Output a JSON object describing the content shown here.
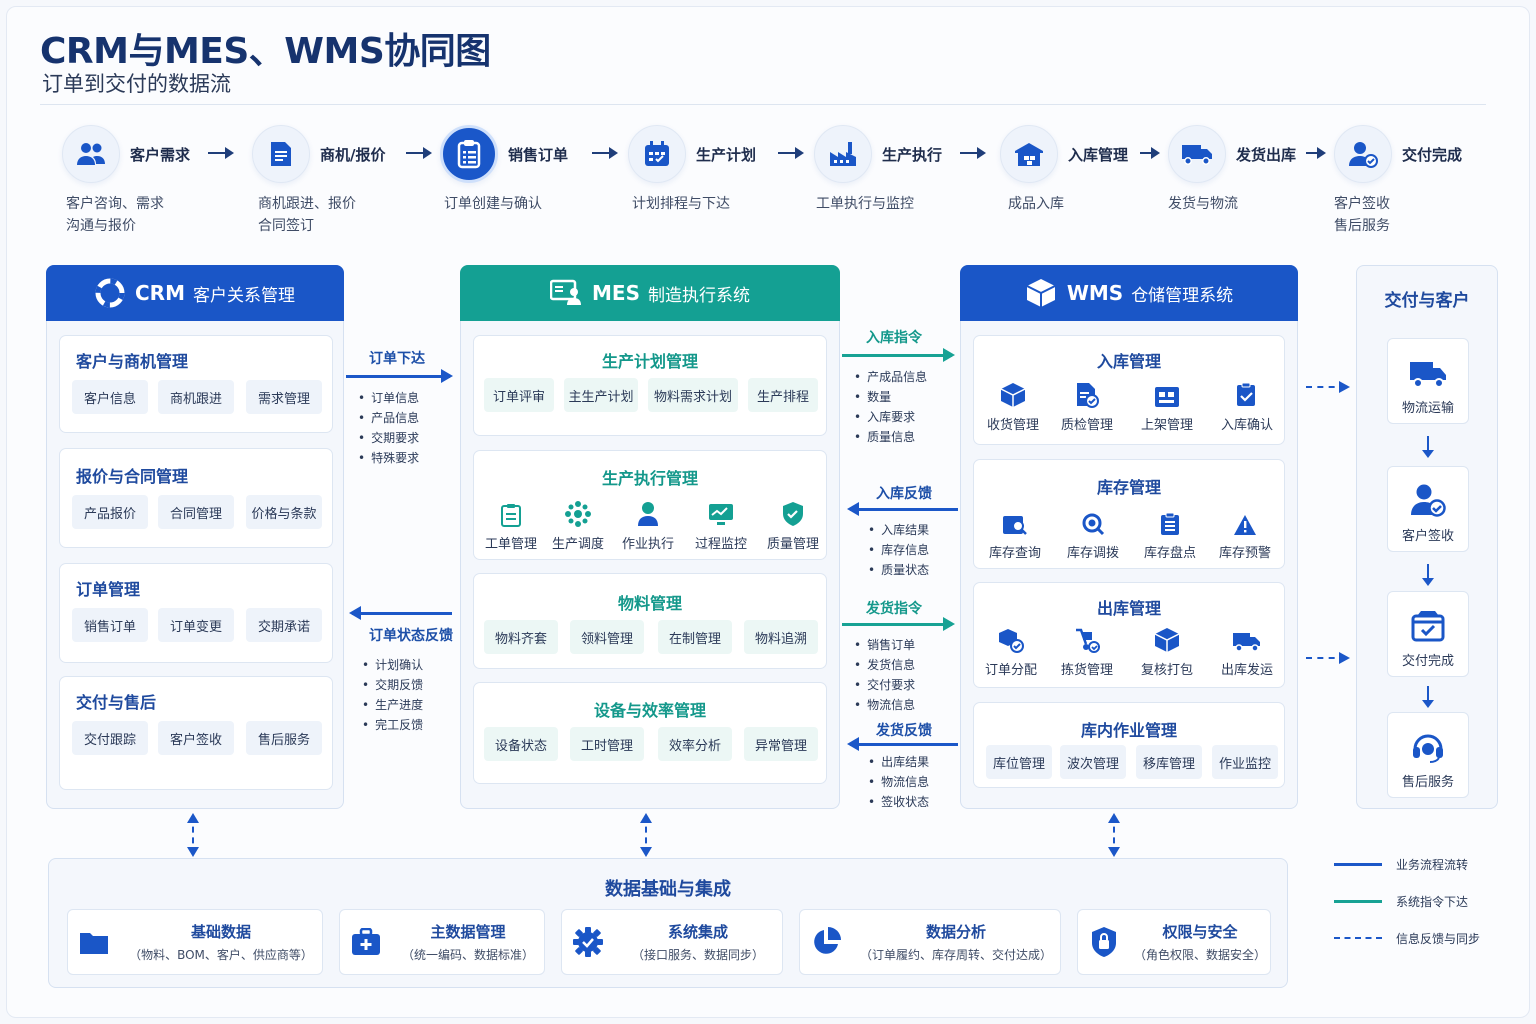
{
  "header": {
    "title": "CRM与MES、WMS协同图",
    "subtitle": "订单到交付的数据流"
  },
  "flow": [
    {
      "label": "客户需求",
      "desc1": "客户咨询、需求",
      "desc2": "沟通与报价",
      "icon": "users-icon"
    },
    {
      "label": "商机/报价",
      "desc1": "商机跟进、报价",
      "desc2": "合同签订",
      "icon": "document-icon"
    },
    {
      "label": "销售订单",
      "desc1": "订单创建与确认",
      "desc2": "",
      "icon": "clipboard-icon"
    },
    {
      "label": "生产计划",
      "desc1": "计划排程与下达",
      "desc2": "",
      "icon": "calendar-icon"
    },
    {
      "label": "生产执行",
      "desc1": "工单执行与监控",
      "desc2": "",
      "icon": "factory-icon"
    },
    {
      "label": "入库管理",
      "desc1": "成品入库",
      "desc2": "",
      "icon": "warehouse-icon"
    },
    {
      "label": "发货出库",
      "desc1": "发货与物流",
      "desc2": "",
      "icon": "truck-icon"
    },
    {
      "label": "交付完成",
      "desc1": "客户签收",
      "desc2": "售后服务",
      "icon": "user-check-icon"
    }
  ],
  "crm": {
    "title": "CRM",
    "subtitle": "客户关系管理",
    "sections": [
      {
        "title": "客户与商机管理",
        "items": [
          "客户信息",
          "商机跟进",
          "需求管理"
        ]
      },
      {
        "title": "报价与合同管理",
        "items": [
          "产品报价",
          "合同管理",
          "价格与条款"
        ]
      },
      {
        "title": "订单管理",
        "items": [
          "销售订单",
          "订单变更",
          "交期承诺"
        ]
      },
      {
        "title": "交付与售后",
        "items": [
          "交付跟踪",
          "客户签收",
          "售后服务"
        ]
      }
    ]
  },
  "mes": {
    "title": "MES",
    "subtitle": "制造执行系统",
    "plan": {
      "title": "生产计划管理",
      "items": [
        "订单评审",
        "主生产计划",
        "物料需求计划",
        "生产排程"
      ]
    },
    "exec": {
      "title": "生产执行管理",
      "items": [
        "工单管理",
        "生产调度",
        "作业执行",
        "过程监控",
        "质量管理"
      ]
    },
    "material": {
      "title": "物料管理",
      "items": [
        "物料齐套",
        "领料管理",
        "在制管理",
        "物料追溯"
      ]
    },
    "equipment": {
      "title": "设备与效率管理",
      "items": [
        "设备状态",
        "工时管理",
        "效率分析",
        "异常管理"
      ]
    }
  },
  "wms": {
    "title": "WMS",
    "subtitle": "仓储管理系统",
    "inbound": {
      "title": "入库管理",
      "items": [
        "收货管理",
        "质检管理",
        "上架管理",
        "入库确认"
      ]
    },
    "inventory": {
      "title": "库存管理",
      "items": [
        "库存查询",
        "库存调拨",
        "库存盘点",
        "库存预警"
      ]
    },
    "outbound": {
      "title": "出库管理",
      "items": [
        "订单分配",
        "拣货管理",
        "复核打包",
        "出库发运"
      ]
    },
    "ops": {
      "title": "库内作业管理",
      "items": [
        "库位管理",
        "波次管理",
        "移库管理",
        "作业监控"
      ]
    }
  },
  "delivery": {
    "title": "交付与客户",
    "items": [
      "物流运输",
      "客户签收",
      "交付完成",
      "售后服务"
    ]
  },
  "connectors": {
    "crm_mes_down": {
      "label": "订单下达",
      "items": [
        "订单信息",
        "产品信息",
        "交期要求",
        "特殊要求"
      ]
    },
    "mes_crm_up": {
      "label": "订单状态反馈",
      "items": [
        "计划确认",
        "交期反馈",
        "生产进度",
        "完工反馈"
      ]
    },
    "mes_wms_in": {
      "label": "入库指令",
      "items": [
        "产成品信息",
        "数量",
        "入库要求",
        "质量信息"
      ]
    },
    "wms_mes_in_fb": {
      "label": "入库反馈",
      "items": [
        "入库结果",
        "库存信息",
        "质量状态"
      ]
    },
    "mes_wms_ship": {
      "label": "发货指令",
      "items": [
        "销售订单",
        "发货信息",
        "交付要求",
        "物流信息"
      ]
    },
    "wms_mes_ship_fb": {
      "label": "发货反馈",
      "items": [
        "出库结果",
        "物流信息",
        "签收状态"
      ]
    }
  },
  "base": {
    "title": "数据基础与集成",
    "cards": [
      {
        "title": "基础数据",
        "desc": "（物料、BOM、客户、供应商等）"
      },
      {
        "title": "主数据管理",
        "desc": "（统一编码、数据标准）"
      },
      {
        "title": "系统集成",
        "desc": "（接口服务、数据同步）"
      },
      {
        "title": "数据分析",
        "desc": "（订单履约、库存周转、交付达成）"
      },
      {
        "title": "权限与安全",
        "desc": "（角色权限、数据安全）"
      }
    ]
  },
  "legend": [
    {
      "label": "业务流程流转",
      "color": "#1b57c8",
      "style": "solid"
    },
    {
      "label": "系统指令下达",
      "color": "#17a294",
      "style": "solid"
    },
    {
      "label": "信息反馈与同步",
      "color": "#1b57c8",
      "style": "dashed"
    }
  ],
  "colors": {
    "primary": "#1a56c7",
    "teal": "#14a093",
    "navy": "#16336e"
  }
}
